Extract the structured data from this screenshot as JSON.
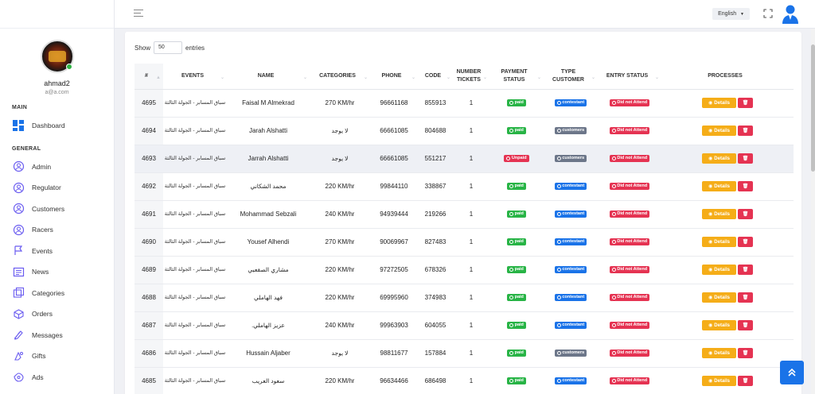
{
  "sidebar": {
    "username": "ahmad2",
    "email": "a@a.com",
    "section_main": "MAIN",
    "section_general": "GENERAL",
    "main_items": [
      {
        "label": "Dashboard",
        "icon": "dashboard-icon"
      }
    ],
    "general_items": [
      {
        "label": "Admin",
        "icon": "admin-icon"
      },
      {
        "label": "Regulator",
        "icon": "regulator-icon"
      },
      {
        "label": "Customers",
        "icon": "customers-icon"
      },
      {
        "label": "Racers",
        "icon": "racers-icon"
      },
      {
        "label": "Events",
        "icon": "events-icon"
      },
      {
        "label": "News",
        "icon": "news-icon"
      },
      {
        "label": "Categories",
        "icon": "categories-icon"
      },
      {
        "label": "Orders",
        "icon": "orders-icon"
      },
      {
        "label": "Messages",
        "icon": "messages-icon"
      },
      {
        "label": "Gifts",
        "icon": "gifts-icon"
      },
      {
        "label": "Ads",
        "icon": "ads-icon"
      }
    ]
  },
  "header": {
    "language": "English"
  },
  "table_controls": {
    "show_label": "Show",
    "entries_value": "50",
    "entries_label": "entries"
  },
  "table": {
    "columns": [
      {
        "key": "id",
        "label": "#"
      },
      {
        "key": "events",
        "label": "EVENTS"
      },
      {
        "key": "name",
        "label": "NAME"
      },
      {
        "key": "categories",
        "label": "CATEGORIES"
      },
      {
        "key": "phone",
        "label": "PHONE"
      },
      {
        "key": "code",
        "label": "CODE"
      },
      {
        "key": "tickets",
        "label": "NUMBER TICKETS"
      },
      {
        "key": "payment",
        "label": "PAYMENT STATUS"
      },
      {
        "key": "type",
        "label": "TYPE CUSTOMER"
      },
      {
        "key": "entry",
        "label": "ENTRY STATUS"
      },
      {
        "key": "processes",
        "label": "PROCESSES"
      }
    ],
    "details_label": "Details",
    "delete_label": "🗑",
    "rows": [
      {
        "id": "4695",
        "event": "سباق المسابر - الجولة الثالثة",
        "name": "Faisal M Almekrad",
        "category": "270 KM/hr",
        "phone": "96661168",
        "code": "855913",
        "tickets": "1",
        "payment": "paid",
        "type": "contestant",
        "entry": "Did not Attend"
      },
      {
        "id": "4694",
        "event": "سباق المسابر - الجولة الثالثة",
        "name": "Jarah Alshatti",
        "category": "لا يوجد",
        "phone": "66661085",
        "code": "804688",
        "tickets": "1",
        "payment": "paid",
        "type": "customers",
        "entry": "Did not Attend"
      },
      {
        "id": "4693",
        "event": "سباق المسابر - الجولة الثالثة",
        "name": "Jarrah Alshatti",
        "category": "لا يوجد",
        "phone": "66661085",
        "code": "551217",
        "tickets": "1",
        "payment": "Unpaid",
        "type": "customers",
        "entry": "Did not Attend"
      },
      {
        "id": "4692",
        "event": "سباق المسابر - الجولة الثالثة",
        "name": "محمد الشكاني",
        "category": "220 KM/hr",
        "phone": "99844110",
        "code": "338867",
        "tickets": "1",
        "payment": "paid",
        "type": "contestant",
        "entry": "Did not Attend"
      },
      {
        "id": "4691",
        "event": "سباق المسابر - الجولة الثالثة",
        "name": "Mohammad Sebzali",
        "category": "240 KM/hr",
        "phone": "94939444",
        "code": "219266",
        "tickets": "1",
        "payment": "paid",
        "type": "contestant",
        "entry": "Did not Attend"
      },
      {
        "id": "4690",
        "event": "سباق المسابر - الجولة الثالثة",
        "name": "Yousef Alhendi",
        "category": "270 KM/hr",
        "phone": "90069967",
        "code": "827483",
        "tickets": "1",
        "payment": "paid",
        "type": "contestant",
        "entry": "Did not Attend"
      },
      {
        "id": "4689",
        "event": "سباق المسابر - الجولة الثالثة",
        "name": "مشاري الصقعبي",
        "category": "220 KM/hr",
        "phone": "97272505",
        "code": "678326",
        "tickets": "1",
        "payment": "paid",
        "type": "contestant",
        "entry": "Did not Attend"
      },
      {
        "id": "4688",
        "event": "سباق المسابر - الجولة الثالثة",
        "name": "فهد الهاملي",
        "category": "220 KM/hr",
        "phone": "69995960",
        "code": "374983",
        "tickets": "1",
        "payment": "paid",
        "type": "contestant",
        "entry": "Did not Attend"
      },
      {
        "id": "4687",
        "event": "سباق المسابر - الجولة الثالثة",
        "name": "عزيز الهاملي.",
        "category": "240 KM/hr",
        "phone": "99963903",
        "code": "604055",
        "tickets": "1",
        "payment": "paid",
        "type": "contestant",
        "entry": "Did not Attend"
      },
      {
        "id": "4686",
        "event": "سباق المسابر - الجولة الثالثة",
        "name": "Hussain Aljaber",
        "category": "لا يوجد",
        "phone": "98811677",
        "code": "157884",
        "tickets": "1",
        "payment": "paid",
        "type": "customers",
        "entry": "Did not Attend"
      },
      {
        "id": "4685",
        "event": "سباق المسابر - الجولة الثالثة",
        "name": "سعود العريب",
        "category": "220 KM/hr",
        "phone": "96634466",
        "code": "686498",
        "tickets": "1",
        "payment": "paid",
        "type": "contestant",
        "entry": "Did not Attend"
      }
    ]
  },
  "colors": {
    "paid": "#28b446",
    "unpaid": "#e53352",
    "contestant": "#1a73e8",
    "customers": "#6c7689",
    "details": "#f5ad18",
    "delete": "#e53352",
    "nav_icon": "#6a5cf0"
  }
}
